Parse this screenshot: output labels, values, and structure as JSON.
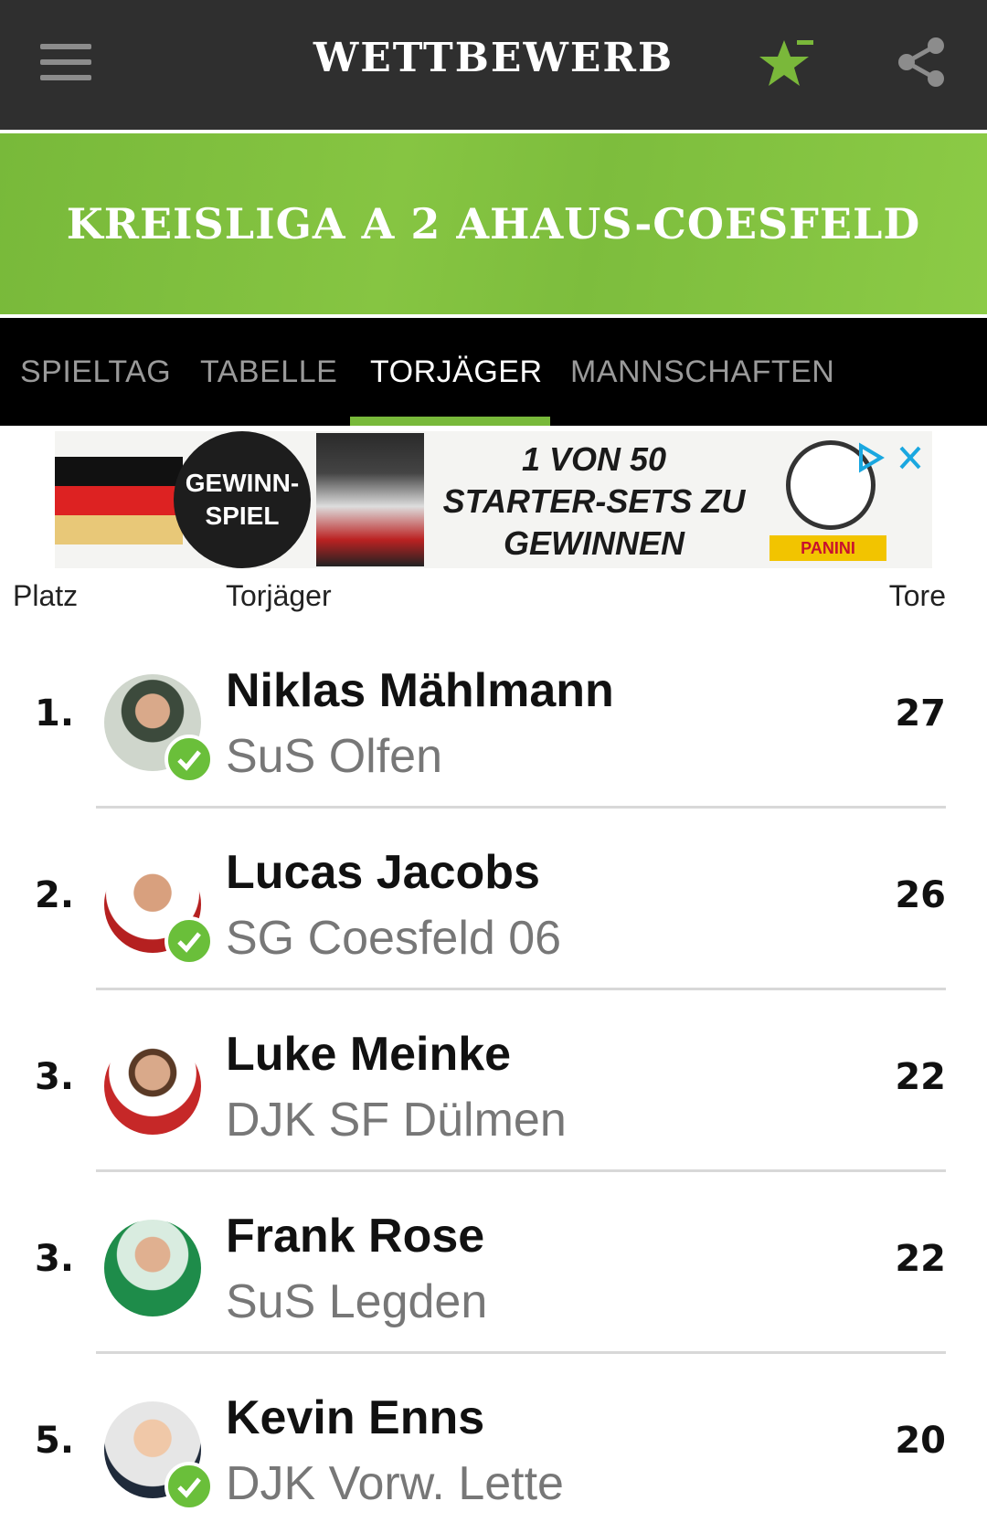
{
  "appbar": {
    "title": "WETTBEWERB"
  },
  "banner": {
    "title": "KREISLIGA A 2 AHAUS-COESFELD"
  },
  "tabs": [
    {
      "label": "SPIELTAG"
    },
    {
      "label": "TABELLE"
    },
    {
      "label": "TORJÄGER",
      "active": true
    },
    {
      "label": "MANNSCHAFTEN"
    }
  ],
  "ad": {
    "badge_line1": "GEWINN-",
    "badge_line2": "SPIEL",
    "text_line1": "1 VON 50",
    "text_line2": "STARTER-SETS ZU",
    "text_line3": "GEWINNEN",
    "brand": "PANINI"
  },
  "table": {
    "headers": {
      "rank": "Platz",
      "player": "Torjäger",
      "goals": "Tore"
    },
    "rows": [
      {
        "rank": "1.",
        "name": "Niklas Mählmann",
        "team": "SuS Olfen",
        "goals": "27",
        "verified": true
      },
      {
        "rank": "2.",
        "name": "Lucas Jacobs",
        "team": "SG Coesfeld 06",
        "goals": "26",
        "verified": true
      },
      {
        "rank": "3.",
        "name": "Luke Meinke",
        "team": "DJK SF Dülmen",
        "goals": "22",
        "verified": false
      },
      {
        "rank": "3.",
        "name": "Frank Rose",
        "team": "SuS Legden",
        "goals": "22",
        "verified": false
      },
      {
        "rank": "5.",
        "name": "Kevin Enns",
        "team": "DJK Vorw. Lette",
        "goals": "20",
        "verified": true
      }
    ]
  },
  "colors": {
    "accent": "#78b93a",
    "appbar": "#2f2f2f",
    "tabbar": "#000000"
  }
}
